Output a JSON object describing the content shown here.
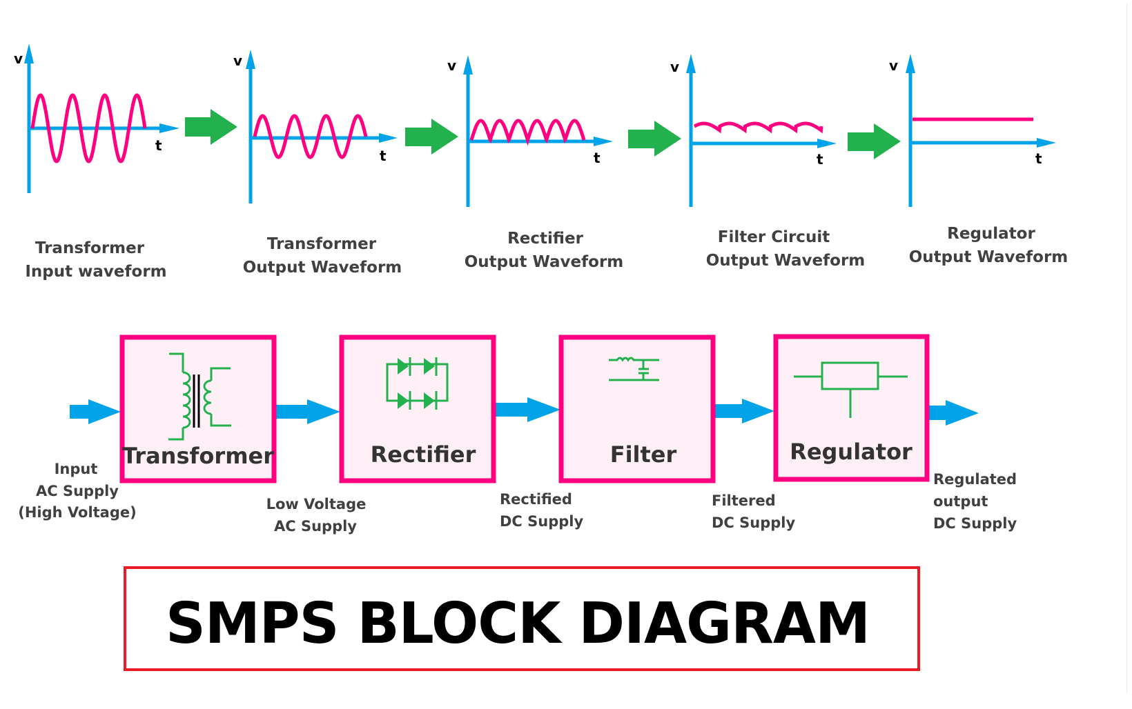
{
  "colors": {
    "axis": "#00a2e8",
    "waveform": "#ff0080",
    "stage_arrow": "#22b14c",
    "block_border": "#ff0080",
    "block_fill": "#fff0f7",
    "symbol": "#22b14c",
    "flow_arrow": "#00a2e8",
    "title_border": "#ed1c24",
    "label_text": "#404040"
  },
  "waveforms": [
    {
      "id": "transformer-input",
      "type": "sine-large",
      "y_label": "v",
      "x_label": "t",
      "caption": [
        "Transformer",
        "Input waveform"
      ]
    },
    {
      "id": "transformer-output",
      "type": "sine-small",
      "y_label": "v",
      "x_label": "t",
      "caption": [
        "Transformer",
        "Output Waveform"
      ]
    },
    {
      "id": "rectifier-output",
      "type": "full-wave-rectified",
      "y_label": "v",
      "x_label": "t",
      "caption": [
        "Rectifier",
        "Output Waveform"
      ]
    },
    {
      "id": "filter-output",
      "type": "ripple-dc",
      "y_label": "v",
      "x_label": "t",
      "caption": [
        "Filter Circuit",
        "Output Waveform"
      ]
    },
    {
      "id": "regulator-output",
      "type": "flat-dc",
      "y_label": "v",
      "x_label": "t",
      "caption": [
        "Regulator",
        "Output Waveform"
      ]
    }
  ],
  "blocks": [
    {
      "id": "transformer",
      "label": "Transformer",
      "icon": "transformer-icon"
    },
    {
      "id": "rectifier",
      "label": "Rectifier",
      "icon": "diode-bridge-icon"
    },
    {
      "id": "filter",
      "label": "Filter",
      "icon": "lc-filter-icon"
    },
    {
      "id": "regulator",
      "label": "Regulator",
      "icon": "regulator-icon"
    }
  ],
  "signals": [
    {
      "id": "input",
      "lines": [
        "Input",
        "AC Supply",
        "(High Voltage)"
      ]
    },
    {
      "id": "low-voltage",
      "lines": [
        "Low Voltage",
        "AC Supply"
      ]
    },
    {
      "id": "rectified",
      "lines": [
        "Rectified",
        "DC Supply"
      ]
    },
    {
      "id": "filtered",
      "lines": [
        "Filtered",
        "DC Supply"
      ]
    },
    {
      "id": "regulated",
      "lines": [
        "Regulated",
        "output",
        "DC Supply"
      ]
    }
  ],
  "title": "SMPS BLOCK DIAGRAM"
}
